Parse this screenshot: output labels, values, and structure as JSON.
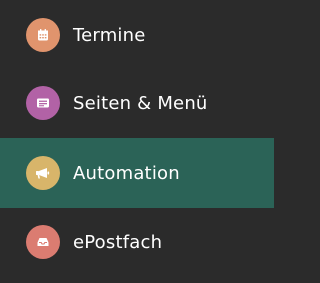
{
  "menu": {
    "items": [
      {
        "label": "Termine",
        "icon": "calendar-icon",
        "color": "#e0946d",
        "active": false
      },
      {
        "label": "Seiten & Menü",
        "icon": "menu-card-icon",
        "color": "#b262a6",
        "active": false
      },
      {
        "label": "Automation",
        "icon": "megaphone-icon",
        "color": "#d8b56a",
        "active": true
      },
      {
        "label": "ePostfach",
        "icon": "inbox-icon",
        "color": "#db7c71",
        "active": false
      }
    ],
    "active_background": "#2b6357",
    "background": "#2b2b2b"
  }
}
